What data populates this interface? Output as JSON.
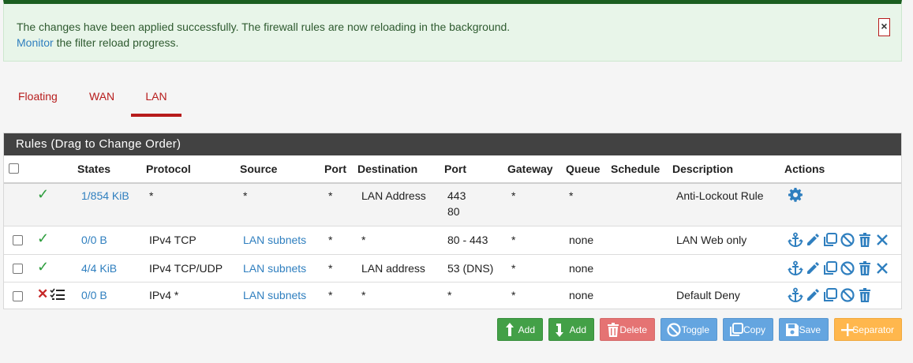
{
  "alert": {
    "line1": "The changes have been applied successfully. The firewall rules are now reloading in the background.",
    "link": "Monitor",
    "line2_rest": " the filter reload progress.",
    "close": "×"
  },
  "tabs": [
    {
      "label": "Floating",
      "active": false
    },
    {
      "label": "WAN",
      "active": false
    },
    {
      "label": "LAN",
      "active": true
    }
  ],
  "panel": {
    "title": "Rules (Drag to Change Order)"
  },
  "columns": {
    "states": "States",
    "protocol": "Protocol",
    "source": "Source",
    "port": "Port",
    "destination": "Destination",
    "dport": "Port",
    "gateway": "Gateway",
    "queue": "Queue",
    "schedule": "Schedule",
    "description": "Description",
    "actions": "Actions"
  },
  "rules": [
    {
      "status": "pass",
      "states": "1/854 KiB",
      "protocol": "*",
      "source": "*",
      "port": "*",
      "destination": "LAN Address",
      "dport1": "443",
      "dport2": "80",
      "gateway": "*",
      "queue": "*",
      "schedule": "",
      "description": "Anti-Lockout Rule",
      "actions": [
        "gear-icon"
      ]
    },
    {
      "status": "pass",
      "states": "0/0 B",
      "protocol": "IPv4 TCP",
      "source": "LAN subnets",
      "port": "*",
      "destination": "*",
      "dport1": "80 - 443",
      "gateway": "*",
      "queue": "none",
      "schedule": "",
      "description": "LAN Web only",
      "actions": [
        "anchor-icon",
        "pencil-icon",
        "copy-icon",
        "block-icon",
        "trash-icon",
        "close-icon"
      ]
    },
    {
      "status": "pass",
      "states": "4/4 KiB",
      "protocol": "IPv4 TCP/UDP",
      "source": "LAN subnets",
      "port": "*",
      "destination": "LAN address",
      "dport1": "53 (DNS)",
      "gateway": "*",
      "queue": "none",
      "schedule": "",
      "description": "",
      "actions": [
        "anchor-icon",
        "pencil-icon",
        "copy-icon",
        "block-icon",
        "trash-icon",
        "close-icon"
      ]
    },
    {
      "status": "block",
      "states": "0/0 B",
      "protocol": "IPv4 *",
      "source": "LAN subnets",
      "port": "*",
      "destination": "*",
      "dport1": "*",
      "gateway": "*",
      "queue": "none",
      "schedule": "",
      "description": "Default Deny",
      "actions": [
        "anchor-icon",
        "pencil-icon",
        "copy-icon",
        "block-icon",
        "trash-icon"
      ]
    }
  ],
  "buttons": {
    "add_top": "Add",
    "add_bottom": "Add",
    "delete": "Delete",
    "toggle": "Toggle",
    "copy": "Copy",
    "save": "Save",
    "separator": "Separator"
  },
  "colors": {
    "accent": "#b71c1c",
    "link": "#2f7fbf",
    "pass": "#2e9e3e",
    "block": "#c62828"
  }
}
